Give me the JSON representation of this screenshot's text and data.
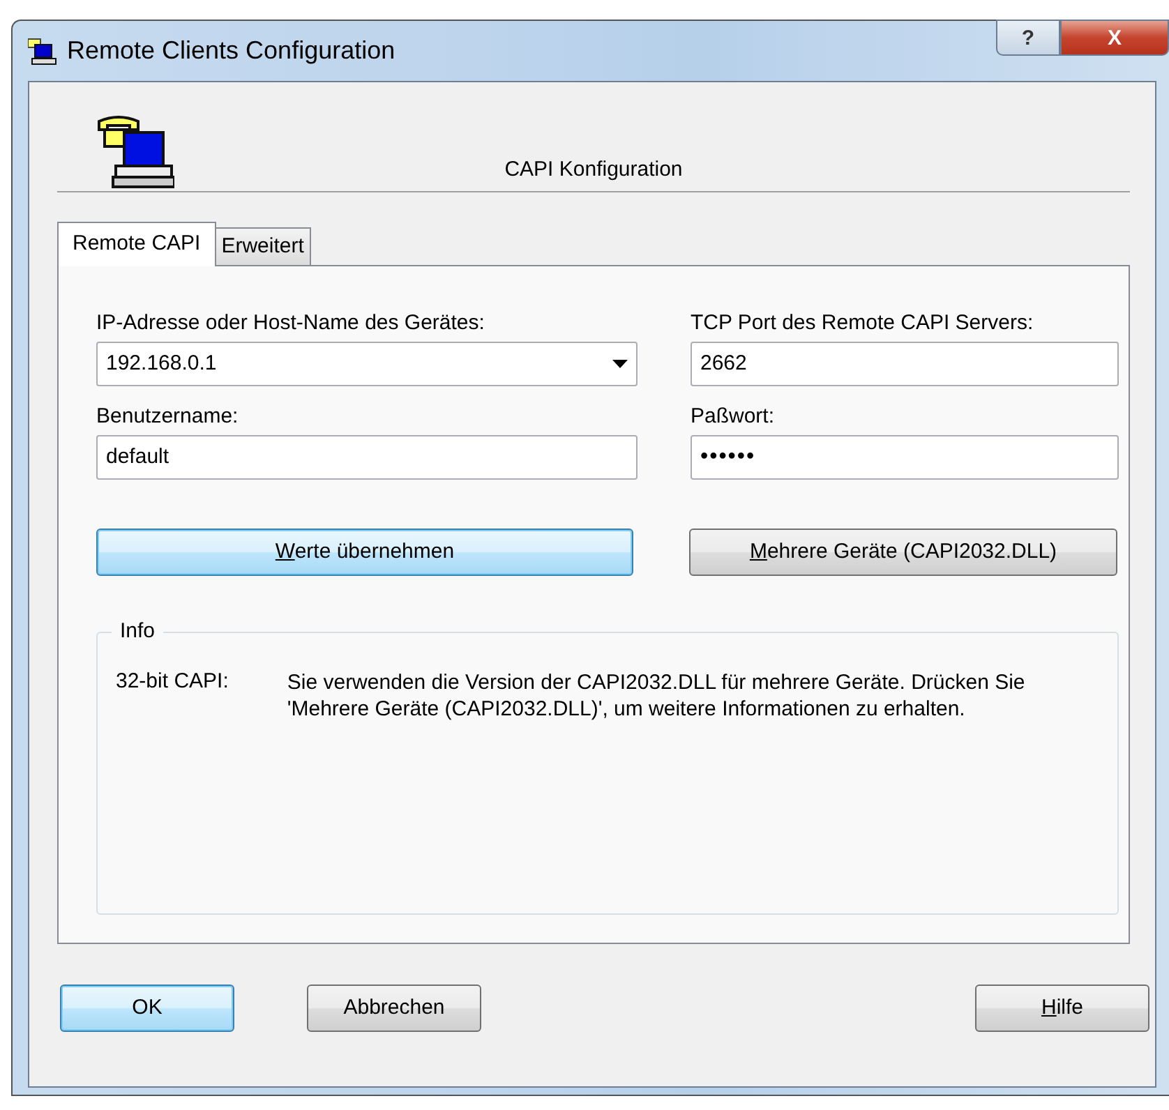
{
  "window": {
    "title": "Remote Clients Configuration",
    "buttons": [
      {
        "kind": "help",
        "label": "?"
      },
      {
        "kind": "close",
        "label": "X"
      }
    ]
  },
  "header": {
    "title": "CAPI Konfiguration"
  },
  "tabs": [
    {
      "label": "Remote CAPI",
      "selected": true
    },
    {
      "label": "Erweitert",
      "selected": false
    }
  ],
  "fields": [
    {
      "kind": "combo",
      "label": "IP-Adresse oder Host-Name des Gerätes:",
      "value": "192.168.0.1"
    },
    {
      "kind": "text",
      "label": "TCP Port des Remote CAPI Servers:",
      "value": "2662"
    },
    {
      "kind": "text",
      "label": "Benutzername:",
      "value": "default"
    },
    {
      "kind": "password",
      "label": "Paßwort:",
      "value": "••••••"
    }
  ],
  "panel_buttons": [
    {
      "label": "Werte übernehmen",
      "underline_first": true,
      "focused": true
    },
    {
      "label": "Mehrere Geräte (CAPI2032.DLL)",
      "underline_first": true,
      "focused": false
    }
  ],
  "info": {
    "title": "Info",
    "term": "32-bit CAPI:",
    "description": "Sie verwenden die Version der CAPI2032.DLL für mehrere Geräte. Drücken Sie 'Mehrere Geräte (CAPI2032.DLL)', um weitere Informationen zu erhalten."
  },
  "dialog_buttons": [
    {
      "label": "OK",
      "underline_first": false,
      "focused": true
    },
    {
      "label": "Abbrechen",
      "underline_first": false,
      "focused": false
    },
    {
      "label": "Hilfe",
      "underline_first": true,
      "focused": false
    }
  ]
}
